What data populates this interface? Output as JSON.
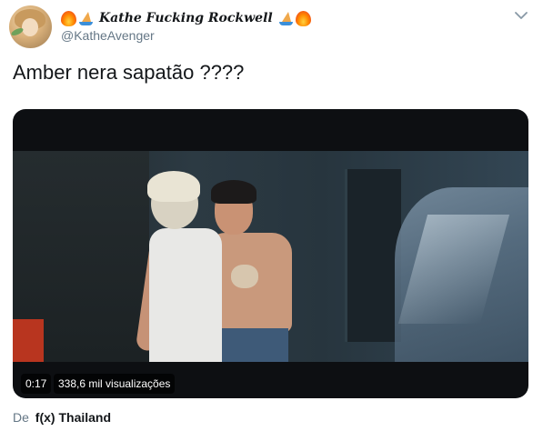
{
  "author": {
    "display_name": "Kathe Fucking Rockwell",
    "handle": "@KatheAvenger",
    "name_emojis_left": [
      "fire-emoji",
      "sailboat-emoji"
    ],
    "name_emojis_right": [
      "sailboat-emoji",
      "fire-emoji"
    ]
  },
  "tweet": {
    "text": "Amber nera sapatão ????"
  },
  "video": {
    "time": "0:17",
    "views": "338,6 mil visualizações"
  },
  "source": {
    "prefix": "De",
    "name": "f(x) Thailand"
  },
  "icons": {
    "menu": "chevron-down-icon"
  },
  "colors": {
    "secondary_text": "#657786",
    "primary_text": "#14171a",
    "video_bg": "#0d0f12"
  }
}
